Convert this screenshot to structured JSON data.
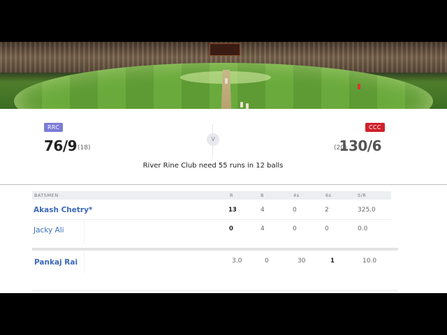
{
  "match": {
    "team_left": {
      "code": "RRC",
      "score": "76/9",
      "overs": "(18)",
      "color": "#7b7bd6"
    },
    "team_right": {
      "code": "CCC",
      "score": "130/6",
      "overs": "(20)",
      "color": "#d0202a"
    },
    "vs_label": "V",
    "status": "River Rine Club need 55 runs in 12 balls"
  },
  "batting": {
    "headers": {
      "name": "BATSMEN",
      "r": "R",
      "b": "B",
      "fours": "4s",
      "sixes": "6s",
      "sr": "S/R"
    },
    "rows": [
      {
        "name": "Akash Chetry*",
        "r": "13",
        "b": "4",
        "fours": "0",
        "sixes": "2",
        "sr": "325.0"
      },
      {
        "name": "Jacky Ali",
        "r": "0",
        "b": "4",
        "fours": "0",
        "sixes": "0",
        "sr": "0.0"
      }
    ]
  },
  "bowling": {
    "rows": [
      {
        "name": "Pankaj Rai",
        "o": "3.0",
        "m": "0",
        "r": "30",
        "w": "1",
        "econ": "10.0"
      }
    ]
  }
}
